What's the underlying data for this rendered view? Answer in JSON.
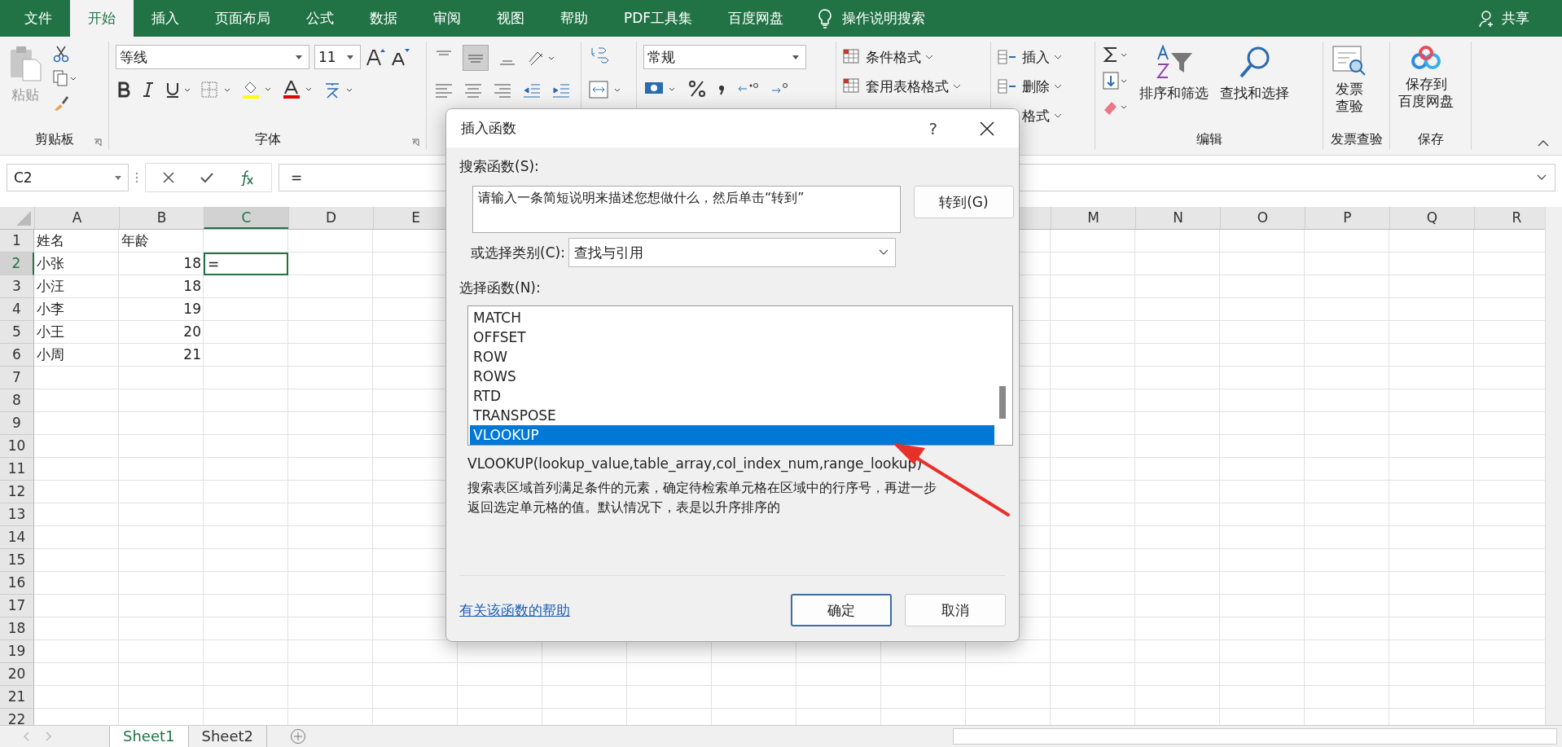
{
  "menu_tabs": [
    {
      "label": "文件",
      "selected": false
    },
    {
      "label": "开始",
      "selected": true
    },
    {
      "label": "插入",
      "selected": false
    },
    {
      "label": "页面布局",
      "selected": false
    },
    {
      "label": "公式",
      "selected": false
    },
    {
      "label": "数据",
      "selected": false
    },
    {
      "label": "审阅",
      "selected": false
    },
    {
      "label": "视图",
      "selected": false
    },
    {
      "label": "帮助",
      "selected": false
    },
    {
      "label": "PDF工具集",
      "selected": false
    },
    {
      "label": "百度网盘",
      "selected": false
    }
  ],
  "tell_me": "操作说明搜索",
  "share": "共享",
  "ribbon": {
    "paste": "粘贴",
    "clipboard_label": "剪贴板",
    "font_name": "等线",
    "font_size": "11",
    "font_label": "字体",
    "number_format": "常规",
    "styles": [
      "条件格式",
      "套用表格格式"
    ],
    "cells": [
      "插入",
      "删除",
      "格式"
    ],
    "sort": "排序和筛选",
    "find": "查找和选择",
    "editing_label": "编辑",
    "invoice": [
      "发票",
      "查验"
    ],
    "invoice_label": "发票查验",
    "save": [
      "保存到",
      "百度网盘"
    ],
    "save_label": "保存"
  },
  "formula_bar": {
    "name_box": "C2",
    "formula": "="
  },
  "columns_left": [
    {
      "label": "A",
      "selected": false
    },
    {
      "label": "B",
      "selected": false
    },
    {
      "label": "C",
      "selected": true
    },
    {
      "label": "D",
      "selected": false
    },
    {
      "label": "E",
      "selected": false
    }
  ],
  "columns_right": [
    {
      "label": "M",
      "selected": false
    },
    {
      "label": "N",
      "selected": false
    },
    {
      "label": "O",
      "selected": false
    },
    {
      "label": "P",
      "selected": false
    },
    {
      "label": "Q",
      "selected": false
    },
    {
      "label": "R",
      "selected": false
    }
  ],
  "rows": [
    {
      "number": "1",
      "selected": false,
      "cells": [
        {
          "text": "姓名",
          "kind": "text"
        },
        {
          "text": "年龄",
          "kind": "text"
        }
      ]
    },
    {
      "number": "2",
      "selected": true,
      "cells": [
        {
          "text": "小张",
          "kind": "text"
        },
        {
          "text": "18",
          "kind": "number"
        },
        {
          "text": "=",
          "kind": "text"
        }
      ]
    },
    {
      "number": "3",
      "selected": false,
      "cells": [
        {
          "text": "小汪",
          "kind": "text"
        },
        {
          "text": "18",
          "kind": "number"
        }
      ]
    },
    {
      "number": "4",
      "selected": false,
      "cells": [
        {
          "text": "小李",
          "kind": "text"
        },
        {
          "text": "19",
          "kind": "number"
        }
      ]
    },
    {
      "number": "5",
      "selected": false,
      "cells": [
        {
          "text": "小王",
          "kind": "text"
        },
        {
          "text": "20",
          "kind": "number"
        }
      ]
    },
    {
      "number": "6",
      "selected": false,
      "cells": [
        {
          "text": "小周",
          "kind": "text"
        },
        {
          "text": "21",
          "kind": "number"
        }
      ]
    },
    {
      "number": "7",
      "selected": false
    },
    {
      "number": "8",
      "selected": false
    },
    {
      "number": "9",
      "selected": false
    },
    {
      "number": "10",
      "selected": false
    },
    {
      "number": "11",
      "selected": false
    },
    {
      "number": "12",
      "selected": false
    },
    {
      "number": "13",
      "selected": false
    },
    {
      "number": "14",
      "selected": false
    },
    {
      "number": "15",
      "selected": false
    },
    {
      "number": "16",
      "selected": false
    },
    {
      "number": "17",
      "selected": false
    },
    {
      "number": "18",
      "selected": false
    },
    {
      "number": "19",
      "selected": false
    },
    {
      "number": "20",
      "selected": false
    },
    {
      "number": "21",
      "selected": false
    },
    {
      "number": "22",
      "selected": false
    }
  ],
  "sheet_tabs": [
    {
      "label": "Sheet1",
      "selected": true
    },
    {
      "label": "Sheet2",
      "selected": false
    }
  ],
  "dialog": {
    "title": "插入函数",
    "help": "?",
    "search_label": "搜索函数(S):",
    "search_value": "请输入一条简短说明来描述您想做什么，然后单击“转到”",
    "go_button": "转到(G)",
    "category_label": "或选择类别(C):",
    "category_value": "查找与引用",
    "function_label": "选择函数(N):",
    "functions": [
      {
        "name": "MATCH",
        "selected": false
      },
      {
        "name": "OFFSET",
        "selected": false
      },
      {
        "name": "ROW",
        "selected": false
      },
      {
        "name": "ROWS",
        "selected": false
      },
      {
        "name": "RTD",
        "selected": false
      },
      {
        "name": "TRANSPOSE",
        "selected": false
      },
      {
        "name": "VLOOKUP",
        "selected": true
      }
    ],
    "signature": "VLOOKUP(lookup_value,table_array,col_index_num,range_lookup)",
    "description": "搜索表区域首列满足条件的元素，确定待检索单元格在区域中的行序号，再进一步返回选定单元格的值。默认情况下，表是以升序排序的",
    "help_link": "有关该函数的帮助",
    "ok": "确定",
    "cancel": "取消"
  }
}
